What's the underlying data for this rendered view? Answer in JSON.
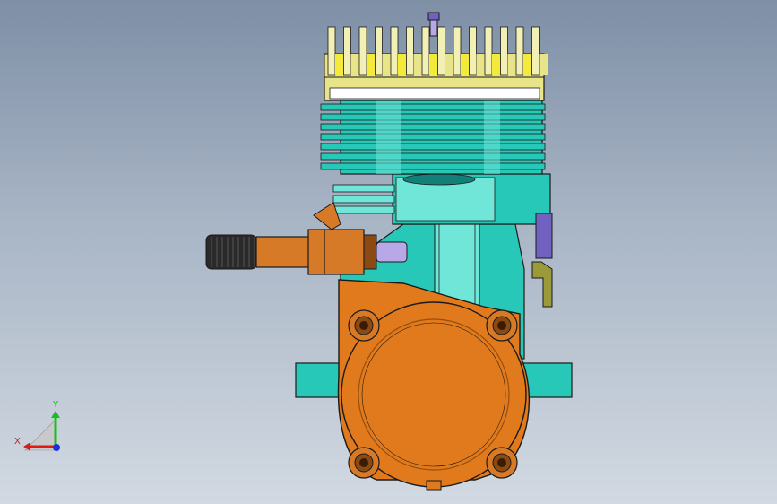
{
  "model": {
    "colors": {
      "head": "#e8e48a",
      "head_fins": "#f2f0b4",
      "head_dark": "#9e9850",
      "cylinder": "#28c8b8",
      "cylinder_light": "#6fe6d8",
      "cylinder_dark": "#128078",
      "crankcase_cover": "#e07a1c",
      "cover_dark": "#9a4e0a",
      "shaft": "#d67a28",
      "shaft_dark": "#8a4a12",
      "knob": "#2a2a2a",
      "plug": "#7060c0",
      "washer": "#b8a8e8",
      "bracket": "#9a9a3a",
      "outline": "#1a1a1a"
    }
  },
  "triad": {
    "x_label": "X",
    "y_label": "Y",
    "x_color": "#e01818",
    "y_color": "#18c018",
    "z_color": "#1830e0"
  }
}
